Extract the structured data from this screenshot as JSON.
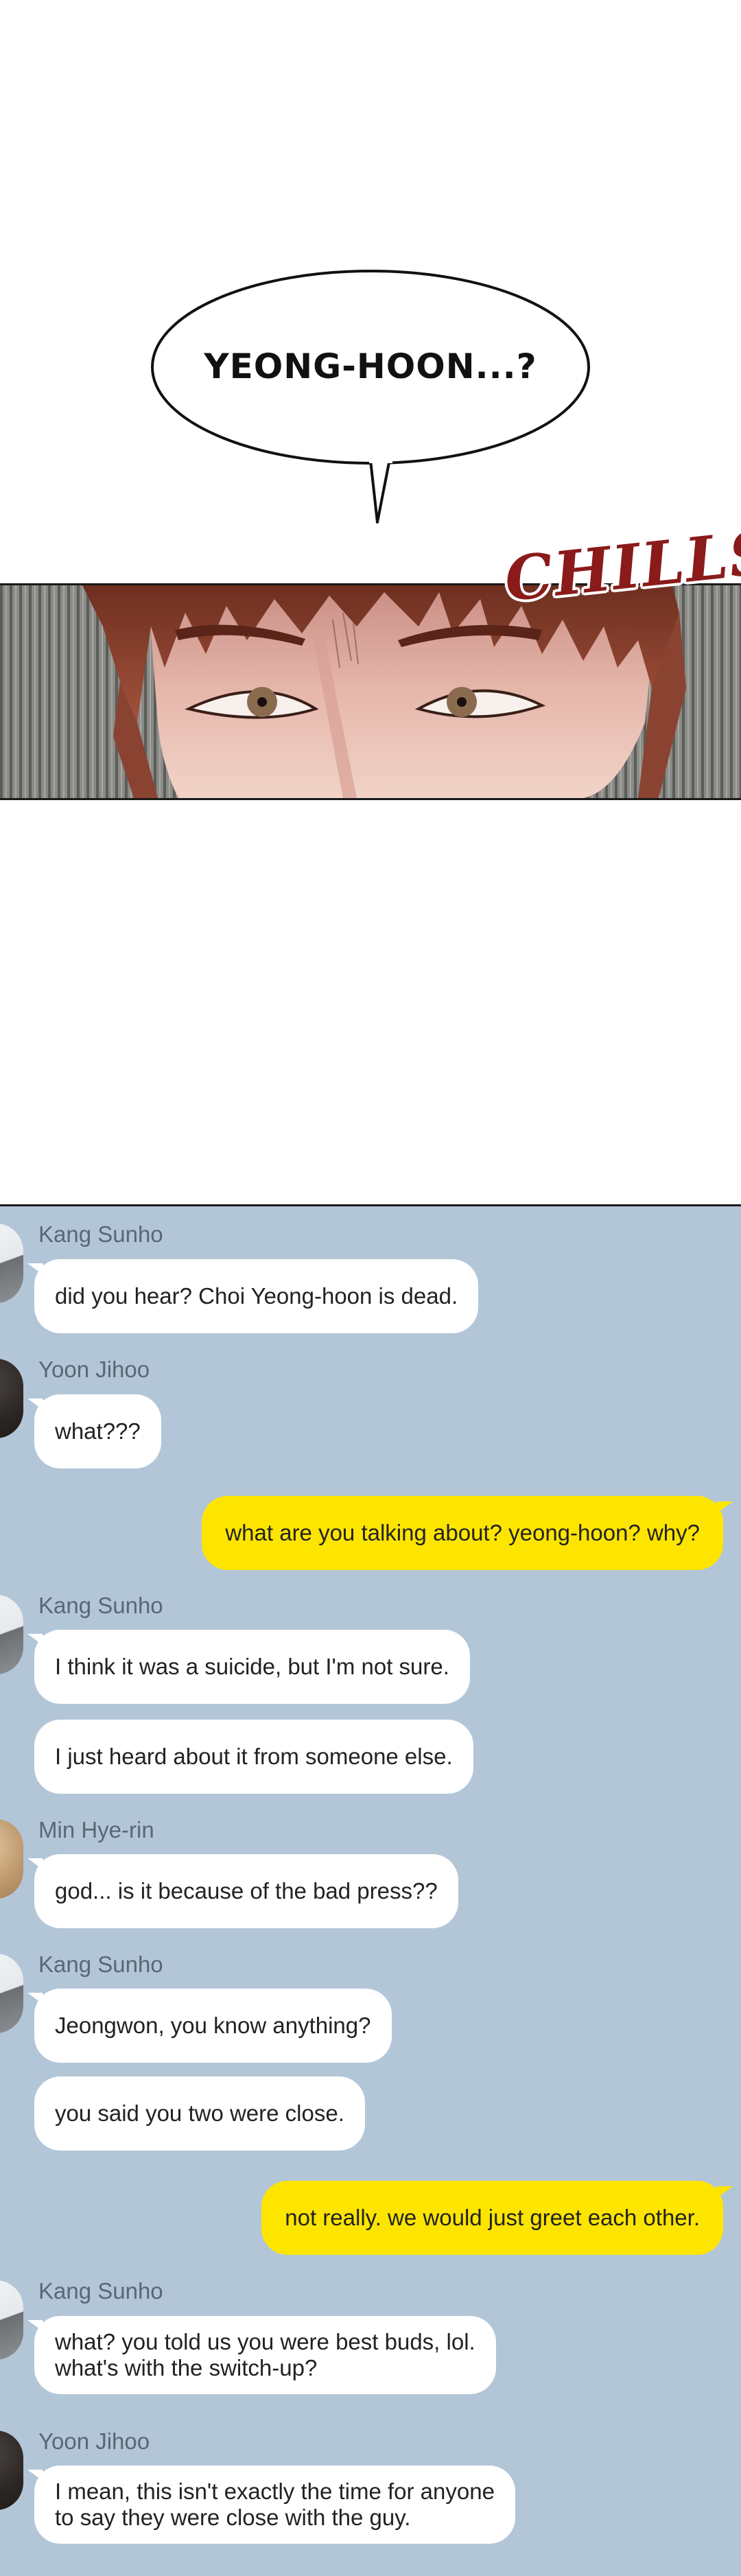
{
  "panel_speech": {
    "text": "YEONG-HOON...?"
  },
  "panel_eyes": {
    "sfx": "CHILLS"
  },
  "chat": {
    "messages": [
      {
        "type": "received",
        "sender": "Kang Sunho",
        "avatar": "kang",
        "lines": [
          "did you hear? Choi Yeong-hoon is dead."
        ]
      },
      {
        "type": "received",
        "sender": "Yoon Jihoo",
        "avatar": "yoon",
        "lines": [
          "what???"
        ]
      },
      {
        "type": "sent",
        "lines": [
          "what are you talking about? yeong-hoon? why?"
        ]
      },
      {
        "type": "received",
        "sender": "Kang Sunho",
        "avatar": "kang",
        "lines": [
          "I think it was a suicide, but I'm not sure."
        ]
      },
      {
        "type": "received_cont",
        "lines": [
          "I just heard about it from someone else."
        ]
      },
      {
        "type": "received",
        "sender": "Min Hye-rin",
        "avatar": "min",
        "lines": [
          "god... is it because of the bad press??"
        ]
      },
      {
        "type": "received",
        "sender": "Kang Sunho",
        "avatar": "kang",
        "lines": [
          "Jeongwon, you know anything?"
        ]
      },
      {
        "type": "received_cont",
        "lines": [
          "you said you two were close."
        ]
      },
      {
        "type": "sent",
        "lines": [
          "not really. we would just greet each other."
        ]
      },
      {
        "type": "received",
        "sender": "Kang Sunho",
        "avatar": "kang",
        "lines": [
          "what? you told us you were best buds, lol.",
          "what's with the switch-up?"
        ]
      },
      {
        "type": "received",
        "sender": "Yoon Jihoo",
        "avatar": "yoon",
        "lines": [
          "I mean, this isn't exactly the time for anyone",
          "to say they were close with the guy."
        ]
      }
    ]
  }
}
